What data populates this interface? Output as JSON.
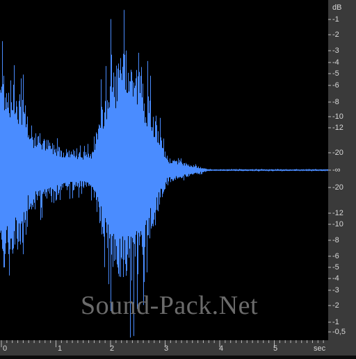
{
  "waveform": {
    "color": "#4a8cff",
    "background": "#000000",
    "center_line": "-∞"
  },
  "db_ruler": {
    "unit": "dB",
    "labels_top": [
      "-1",
      "-2",
      "-3",
      "-4",
      "-5",
      "-6",
      "-8",
      "-10",
      "-12",
      "-20",
      "-∞"
    ],
    "labels_bottom": [
      "-20",
      "-12",
      "-10",
      "-8",
      "-6",
      "-5",
      "-4",
      "-3",
      "-2",
      "-1",
      "-0,5"
    ]
  },
  "time_ruler": {
    "unit": "sec",
    "labels": [
      "0",
      "1",
      "2",
      "3",
      "4",
      "5"
    ]
  },
  "watermark": "Sound-Pack.Net"
}
